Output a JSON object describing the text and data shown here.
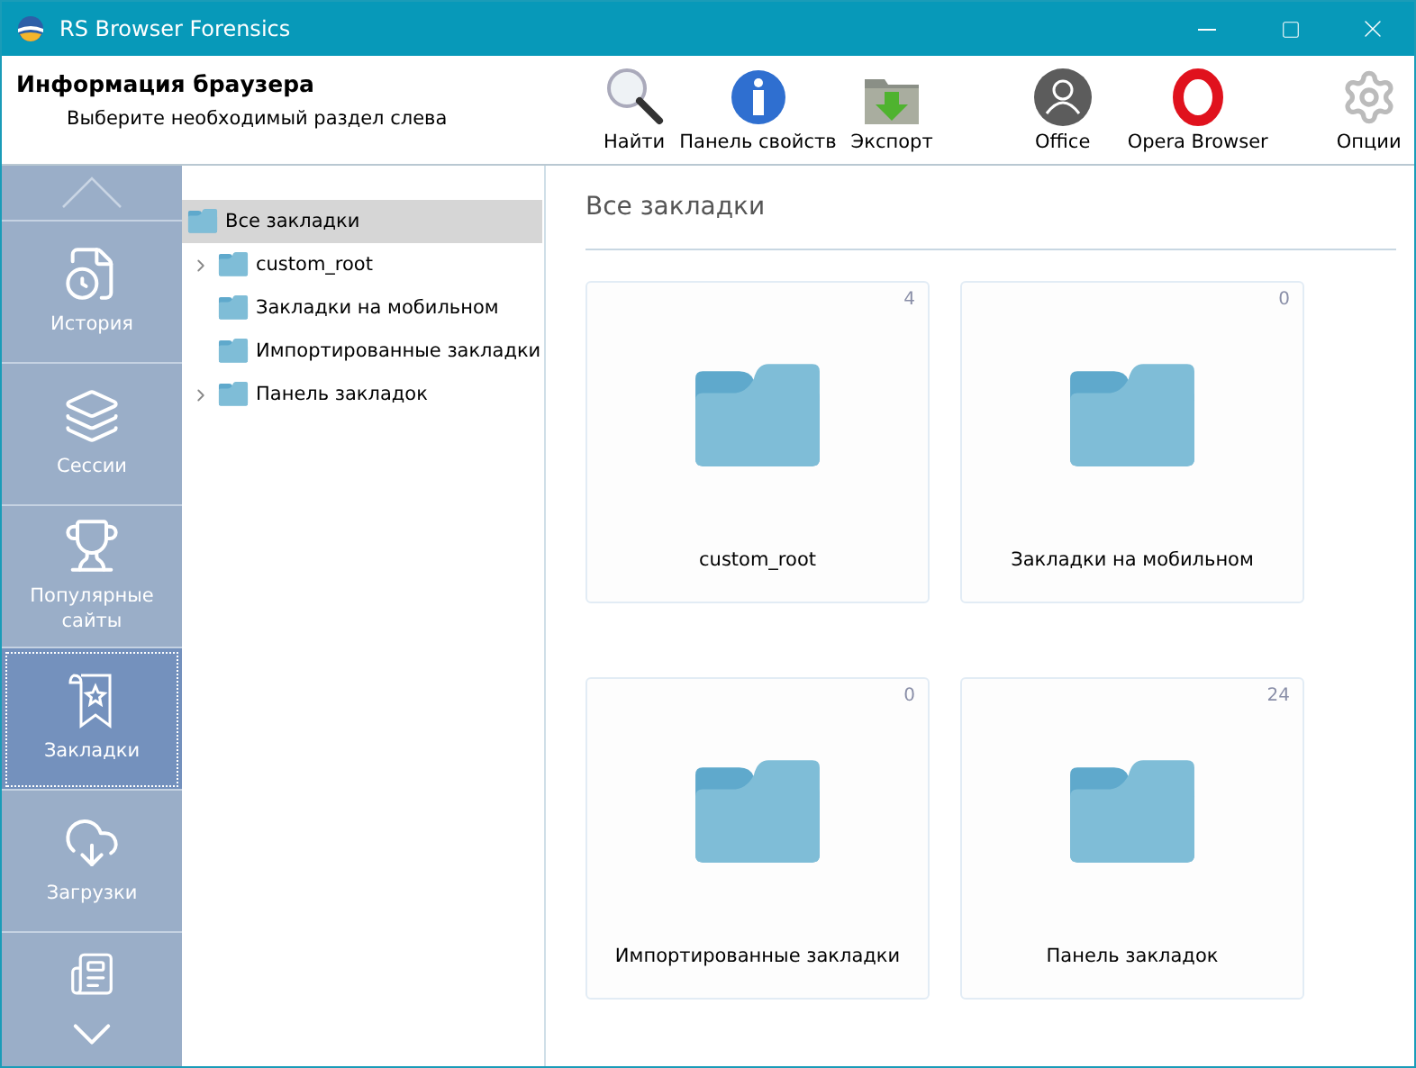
{
  "window": {
    "title": "RS Browser Forensics"
  },
  "header": {
    "title": "Информация браузера",
    "subtitle": "Выберите необходимый раздел слева"
  },
  "toolbar": [
    {
      "kind": "search",
      "label": "Найти"
    },
    {
      "kind": "info",
      "label": "Панель свойств"
    },
    {
      "kind": "export",
      "label": "Экспорт"
    },
    {
      "kind": "profile",
      "label": "Office"
    },
    {
      "kind": "opera",
      "label": "Opera Browser"
    },
    {
      "kind": "options",
      "label": "Опции"
    }
  ],
  "sidebar": {
    "items": [
      {
        "kind": "history",
        "label": "История",
        "selected": false
      },
      {
        "kind": "sessions",
        "label": "Сессии",
        "selected": false
      },
      {
        "kind": "popular",
        "label": "Популярные сайты",
        "selected": false
      },
      {
        "kind": "bookmarks",
        "label": "Закладки",
        "selected": true
      },
      {
        "kind": "downloads",
        "label": "Загрузки",
        "selected": false
      },
      {
        "kind": "pages",
        "selected": false
      }
    ]
  },
  "tree": [
    {
      "label": "Все закладки",
      "selected": true,
      "expandable": false,
      "root": true
    },
    {
      "label": "custom_root",
      "selected": false,
      "expandable": true,
      "root": false
    },
    {
      "label": "Закладки на мобильном",
      "selected": false,
      "expandable": false,
      "root": false
    },
    {
      "label": "Импортированные закладки",
      "selected": false,
      "expandable": false,
      "root": false
    },
    {
      "label": "Панель закладок",
      "selected": false,
      "expandable": true,
      "root": false
    }
  ],
  "content": {
    "title": "Все закладки",
    "folders": [
      {
        "name": "custom_root",
        "count": "4"
      },
      {
        "name": "Закладки на мобильном",
        "count": "0"
      },
      {
        "name": "Импортированные закладки",
        "count": "0"
      },
      {
        "name": "Панель закладок",
        "count": "24"
      }
    ]
  }
}
